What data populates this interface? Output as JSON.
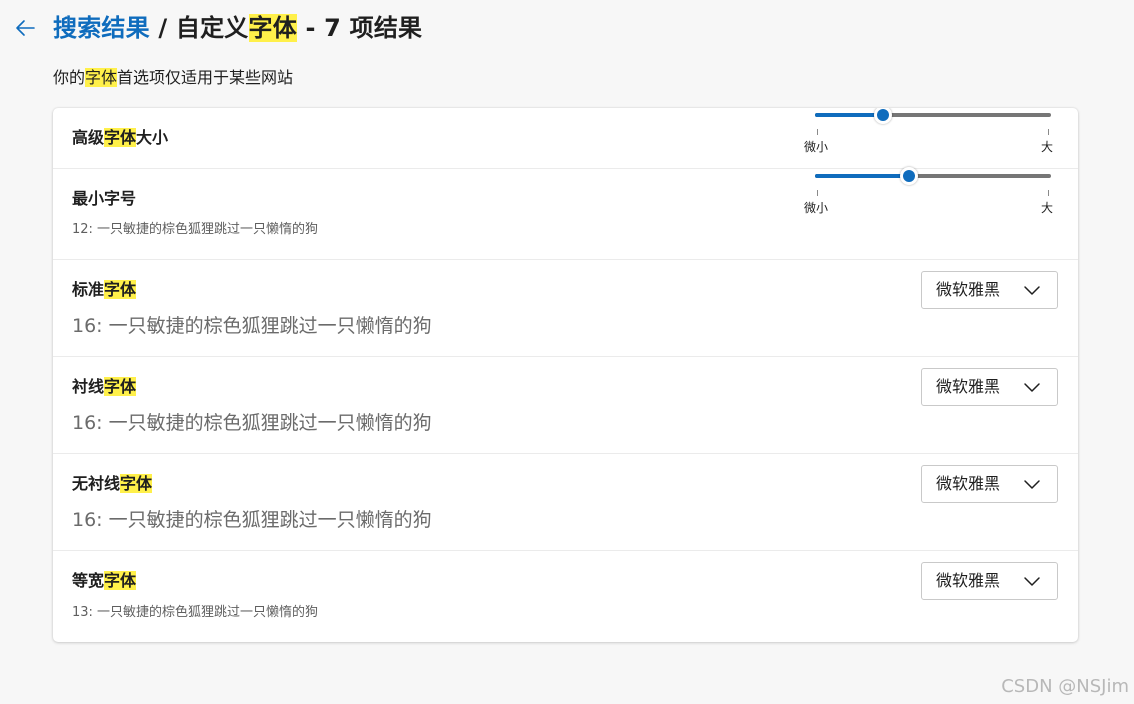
{
  "header": {
    "back_icon": "arrow-left-icon",
    "breadcrumb_link": "搜索结果",
    "separator": " / ",
    "title_prefix": "自定义",
    "title_highlight": "字体",
    "title_suffix": " - 7 项结果"
  },
  "subtitle": {
    "prefix": "你的",
    "highlight": "字体",
    "suffix": "首选项仅适用于某些网站"
  },
  "rows": {
    "advanced_size": {
      "label_prefix": "高级",
      "label_highlight": "字体",
      "label_suffix": "大小",
      "slider_min_label": "微小",
      "slider_max_label": "大",
      "slider_value_fraction": 0.29
    },
    "min_size": {
      "label": "最小字号",
      "sample": "12: 一只敏捷的棕色狐狸跳过一只懒惰的狗",
      "slider_min_label": "微小",
      "slider_max_label": "大",
      "slider_value_fraction": 0.4
    },
    "standard": {
      "label_prefix": "标准",
      "label_highlight": "字体",
      "sample": "16: 一只敏捷的棕色狐狸跳过一只懒惰的狗",
      "dropdown_value": "微软雅黑",
      "dropdown_icon": "chevron-down-icon"
    },
    "serif": {
      "label_prefix": "衬线",
      "label_highlight": "字体",
      "sample": "16: 一只敏捷的棕色狐狸跳过一只懒惰的狗",
      "dropdown_value": "微软雅黑",
      "dropdown_icon": "chevron-down-icon"
    },
    "sans_serif": {
      "label_prefix": "无衬线",
      "label_highlight": "字体",
      "sample": "16: 一只敏捷的棕色狐狸跳过一只懒惰的狗",
      "dropdown_value": "微软雅黑",
      "dropdown_icon": "chevron-down-icon"
    },
    "monospace": {
      "label_prefix": "等宽",
      "label_highlight": "字体",
      "sample": "13: 一只敏捷的棕色狐狸跳过一只懒惰的狗",
      "dropdown_value": "微软雅黑",
      "dropdown_icon": "chevron-down-icon"
    }
  },
  "watermark": "CSDN @NSJim",
  "colors": {
    "accent": "#0f6cbd",
    "highlight": "#fff04a",
    "background": "#f7f7f7",
    "card": "#ffffff"
  }
}
